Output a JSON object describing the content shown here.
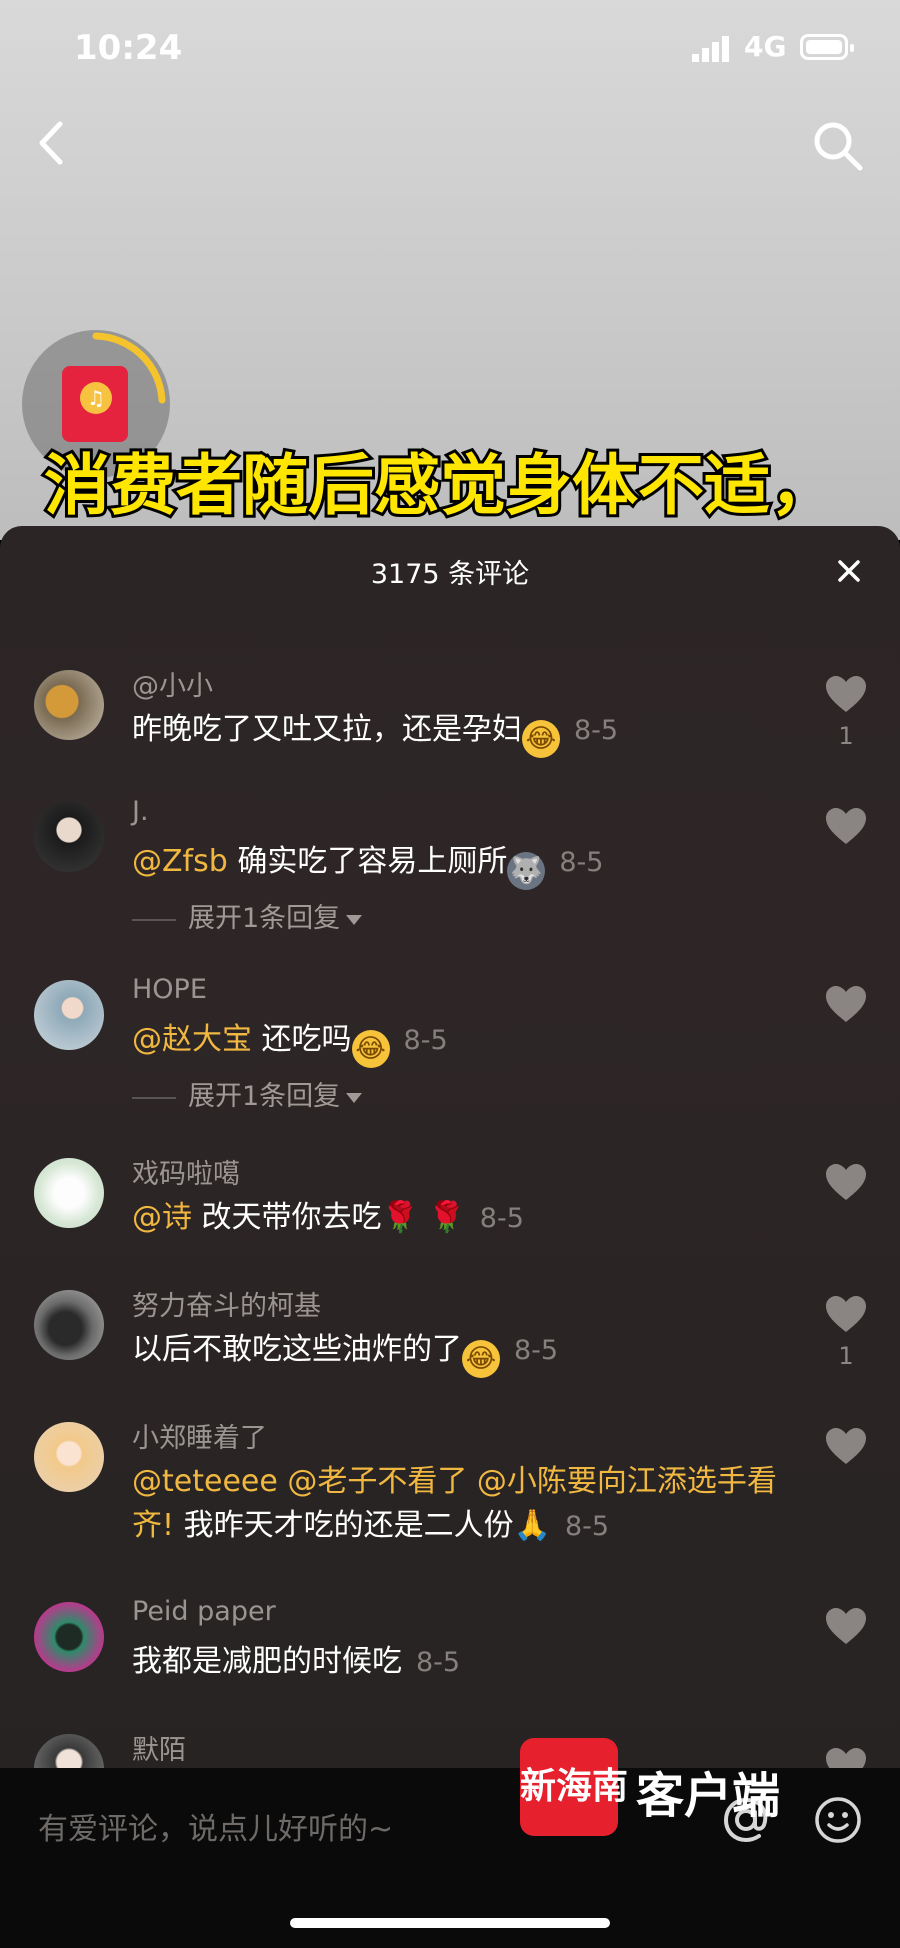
{
  "status": {
    "time": "10:24",
    "network": "4G"
  },
  "video": {
    "subtitle": "消费者随后感觉身体不适，"
  },
  "sheet": {
    "count_label": "3175 条评论"
  },
  "comments": [
    {
      "user": "@小小",
      "segments": [
        {
          "t": "昨晚吃了又吐又拉，还是孕妇",
          "m": false
        }
      ],
      "emoji": "😂",
      "date": "8-5",
      "likes": "1"
    },
    {
      "user": "J.",
      "segments": [
        {
          "t": "@Zfsb",
          "m": true
        },
        {
          "t": " 确实吃了容易上厕所",
          "m": false
        }
      ],
      "emoji": "🐺",
      "date": "8-5",
      "likes": "",
      "replies": "展开1条回复"
    },
    {
      "user": "HOPE",
      "segments": [
        {
          "t": "@赵大宝",
          "m": true
        },
        {
          "t": " 还吃吗",
          "m": false
        }
      ],
      "emoji": "😂",
      "date": "8-5",
      "likes": "",
      "replies": "展开1条回复"
    },
    {
      "user": "戏码啦噶",
      "segments": [
        {
          "t": "@诗",
          "m": true
        },
        {
          "t": " 改天带你去吃",
          "m": false
        }
      ],
      "emoji": "🌹 🌹",
      "date": "8-5",
      "likes": ""
    },
    {
      "user": "努力奋斗的柯基",
      "segments": [
        {
          "t": "以后不敢吃这些油炸的了",
          "m": false
        }
      ],
      "emoji": "😂",
      "date": "8-5",
      "likes": "1"
    },
    {
      "user": "小郑睡着了",
      "segments": [
        {
          "t": "@teteeee @老子不看了 @小陈要向江添选手看齐!",
          "m": true
        },
        {
          "t": "  我昨天才吃的还是二人份",
          "m": false
        }
      ],
      "emoji": "🙏",
      "date": "8-5",
      "likes": ""
    },
    {
      "user": "Peid paper",
      "segments": [
        {
          "t": "我都是减肥的时候吃",
          "m": false
        }
      ],
      "emoji": "",
      "date": "8-5",
      "likes": ""
    },
    {
      "user": "默陌",
      "segments": [],
      "emoji": "",
      "date": "",
      "likes": ""
    }
  ],
  "composer": {
    "placeholder": "有爱评论，说点儿好听的~"
  },
  "watermark": {
    "badge": "新海南",
    "text": "客户端"
  },
  "colors": {
    "mention": "#f0b840",
    "sheet": "#2c2525",
    "subtitle": "#ffe600"
  }
}
